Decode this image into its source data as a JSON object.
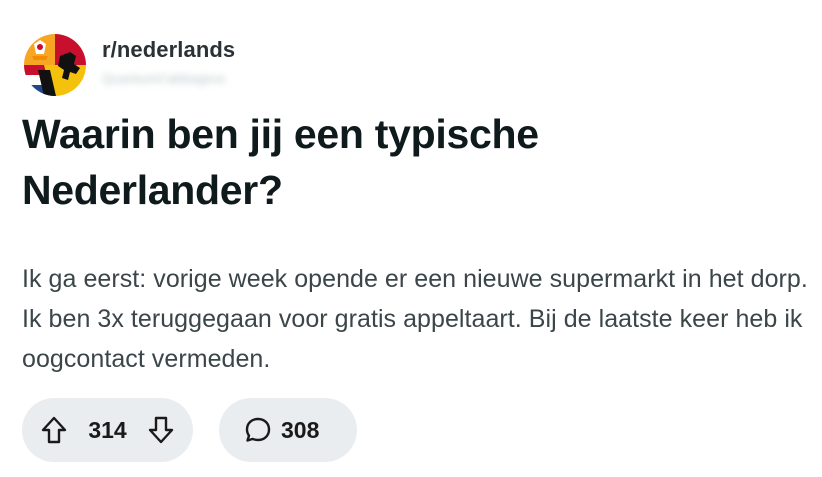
{
  "post": {
    "subreddit": "r/nederlands",
    "username": "QuantumCabbagexx",
    "title": "Waarin ben jij een typische Nederlander?",
    "body": "Ik ga eerst: vorige week opende er een nieuwe supermarkt in het dorp. Ik ben 3x teruggegaan voor gratis appeltaart. Bij de laatste keer heb ik oogcontact vermeden."
  },
  "actions": {
    "upvote_icon": "arrow-up-icon",
    "downvote_icon": "arrow-down-icon",
    "vote_count": "314",
    "comment_icon": "speech-bubble-icon",
    "comment_count": "308"
  },
  "colors": {
    "pill_background": "#eaedef",
    "title": "#0f1a1c",
    "body": "#3b4649",
    "flag_red": "#c8102e",
    "flag_blue": "#21468b",
    "flag_yellow": "#f4c20d",
    "flag_orange": "#f28c00"
  }
}
